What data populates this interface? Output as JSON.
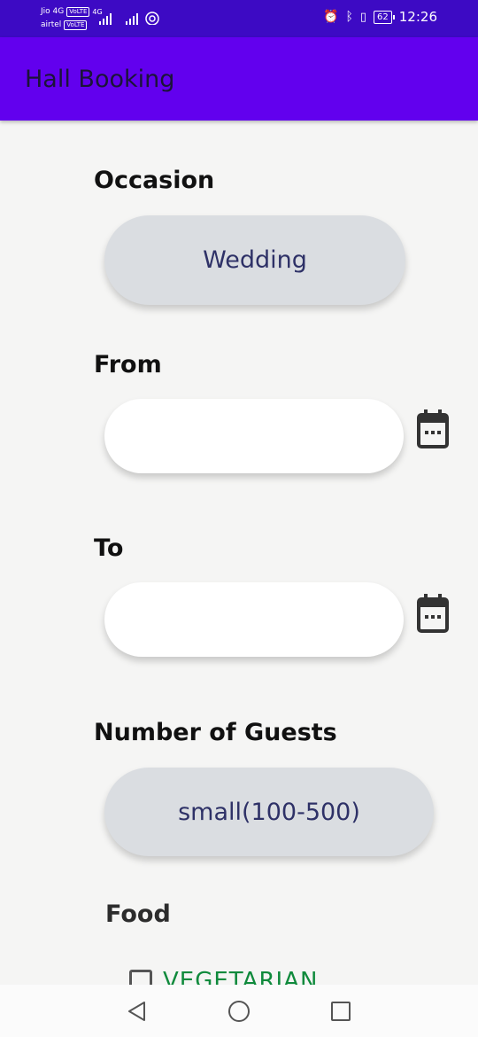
{
  "status_bar": {
    "carrier1": "Jio 4G",
    "carrier1_tag": "VoLTE",
    "carrier2": "airtel",
    "carrier2_tag": "VoLTE",
    "net": "4G",
    "battery": "62",
    "time": "12:26"
  },
  "app_bar": {
    "title": "Hall Booking"
  },
  "form": {
    "occasion": {
      "label": "Occasion",
      "value": "Wedding"
    },
    "from": {
      "label": "From",
      "value": ""
    },
    "to": {
      "label": "To",
      "value": ""
    },
    "guests": {
      "label": "Number of Guests",
      "value": "small(100-500)"
    },
    "food": {
      "label": "Food",
      "options": [
        {
          "label": "VEGETARIAN",
          "checked": false
        }
      ]
    }
  },
  "icons": {
    "calendar": "calendar-icon",
    "back": "back-icon",
    "home": "home-icon",
    "recents": "recents-icon"
  },
  "colors": {
    "status_bar": "#3d0ac4",
    "app_bar": "#6200ee",
    "spinner_bg": "#dadde1",
    "spinner_text": "#2e3167",
    "checkbox_text": "#0f8a3c"
  }
}
